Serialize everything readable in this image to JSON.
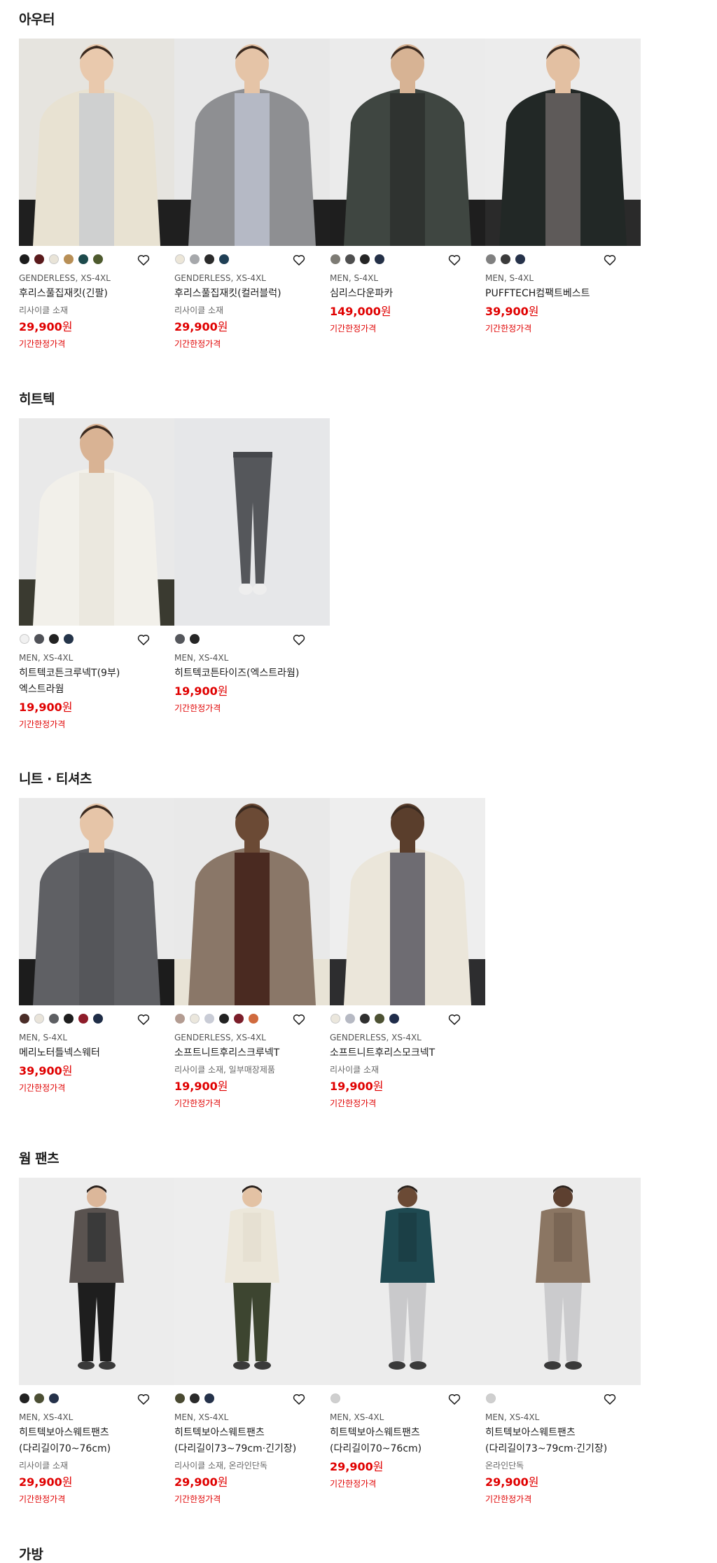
{
  "sections": [
    {
      "title": "아우터",
      "products": [
        {
          "swatches": [
            "#1c1c1c",
            "#5a1a1c",
            "#e9e4d8",
            "#b88f56",
            "#1d4a4c",
            "#4e5a2e"
          ],
          "meta": "GENDERLESS, XS-4XL",
          "name": "후리스풀집재킷(긴팔)",
          "note": "리사이클 소재",
          "price": "29,900",
          "currency": "원",
          "flag": "기간한정가격",
          "photo": {
            "bg": "#e6e4df",
            "top": "#e8e2d2",
            "inner": "#cfd0d0",
            "bottom": "#1f1f1f",
            "skin": "#e9c9ad"
          }
        },
        {
          "swatches": [
            "#ece6d8",
            "#a6a8ab",
            "#2b2b2b",
            "#1f3f55"
          ],
          "meta": "GENDERLESS, XS-4XL",
          "name": "후리스풀집재킷(컬러블럭)",
          "note": "리사이클 소재",
          "price": "29,900",
          "currency": "원",
          "flag": "기간한정가격",
          "photo": {
            "bg": "#e8e8e8",
            "top": "#8e8f92",
            "inner": "#b5b9c5",
            "bottom": "#1f1f1f",
            "skin": "#e5c4a7"
          }
        },
        {
          "swatches": [
            "#7d7b74",
            "#4f4f4f",
            "#252525",
            "#243047"
          ],
          "meta": "MEN, S-4XL",
          "name": "심리스다운파카",
          "note": "",
          "price": "149,000",
          "currency": "원",
          "flag": "기간한정가격",
          "photo": {
            "bg": "#ebebeb",
            "top": "#3f4641",
            "inner": "#2f3330",
            "bottom": "#1e1e1e",
            "skin": "#d7b394"
          }
        },
        {
          "swatches": [
            "#808080",
            "#3b3b3b",
            "#26324a"
          ],
          "meta": "MEN, S-4XL",
          "name": "PUFFTECH컴팩트베스트",
          "note": "",
          "price": "39,900",
          "currency": "원",
          "flag": "기간한정가격",
          "photo": {
            "bg": "#ececec",
            "top": "#222826",
            "inner": "#5e5a59",
            "bottom": "#2a2a2a",
            "skin": "#e3c0a2"
          }
        }
      ]
    },
    {
      "title": "히트텍",
      "products": [
        {
          "swatches": [
            "#f1f1f1",
            "#505258",
            "#222222",
            "#25354a"
          ],
          "meta": "MEN, XS-4XL",
          "name": "히트텍코튼크루넥T(9부)엑스트라웜",
          "note": "",
          "price": "19,900",
          "currency": "원",
          "flag": "기간한정가격",
          "photo": {
            "bg": "#e9e9e9",
            "top": "#f2f0ea",
            "inner": "#ebe8df",
            "bottom": "#3a3a30",
            "skin": "#d9b394"
          }
        },
        {
          "swatches": [
            "#55575c",
            "#262626"
          ],
          "meta": "MEN, XS-4XL",
          "name": "히트텍코튼타이즈(엑스트라웜)",
          "note": "",
          "price": "19,900",
          "currency": "원",
          "flag": "기간한정가격",
          "photo": {
            "bg": "#e6e7e9",
            "top": "#55575b",
            "inner": "#55575b",
            "bottom": "#55575b",
            "skin": "#eeeeee"
          }
        }
      ]
    },
    {
      "title": "니트 · 티셔츠",
      "products": [
        {
          "swatches": [
            "#4a2d28",
            "#e9e4da",
            "#5d5f63",
            "#1e1e1e",
            "#8e1c2a",
            "#1f2d47"
          ],
          "meta": "MEN, S-4XL",
          "name": "메리노터틀넥스웨터",
          "note": "",
          "price": "39,900",
          "currency": "원",
          "flag": "기간한정가격",
          "photo": {
            "bg": "#eaeaea",
            "top": "#5f6064",
            "inner": "#55565a",
            "bottom": "#1c1c1c",
            "skin": "#e6c5a8"
          }
        },
        {
          "swatches": [
            "#b39c92",
            "#ebe7dd",
            "#c9ccd6",
            "#222222",
            "#7b1e2a",
            "#d06a3e"
          ],
          "meta": "GENDERLESS, XS-4XL",
          "name": "소프트니트후리스크루넥T",
          "note": "리사이클 소재, 일부매장제품",
          "price": "19,900",
          "currency": "원",
          "flag": "기간한정가격",
          "photo": {
            "bg": "#e9e9e9",
            "top": "#8a7768",
            "inner": "#4a2a21",
            "bottom": "#e8e3d6",
            "skin": "#6b4a35"
          }
        },
        {
          "swatches": [
            "#ebe7dd",
            "#b6b9c3",
            "#2f2f2f",
            "#4d5233",
            "#1f2c4a"
          ],
          "meta": "GENDERLESS, XS-4XL",
          "name": "소프트니트후리스모크넥T",
          "note": "리사이클 소재",
          "price": "19,900",
          "currency": "원",
          "flag": "기간한정가격",
          "photo": {
            "bg": "#eeeeee",
            "top": "#ebe6da",
            "inner": "#6e6c72",
            "bottom": "#2d2d2f",
            "skin": "#5a3e2c"
          }
        }
      ]
    },
    {
      "title": "웜 팬츠",
      "products": [
        {
          "swatches": [
            "#222222",
            "#4c4f34",
            "#25324a"
          ],
          "meta": "MEN, XS-4XL",
          "name": "히트텍보아스웨트팬츠(다리길이70~76cm)",
          "note": "리사이클 소재",
          "price": "29,900",
          "currency": "원",
          "flag": "기간한정가격",
          "photo": {
            "bg": "#ececec",
            "top": "#5a5350",
            "inner": "#3a3a3a",
            "bottom": "#1e1e1e",
            "skin": "#dcb79a"
          }
        },
        {
          "swatches": [
            "#4a4a32",
            "#2a2a2a",
            "#25324a"
          ],
          "meta": "MEN, XS-4XL",
          "name": "히트텍보아스웨트팬츠(다리길이73~79cm·긴기장)",
          "note": "리사이클 소재, 온라인단독",
          "price": "29,900",
          "currency": "원",
          "flag": "기간한정가격",
          "photo": {
            "bg": "#ededed",
            "top": "#ece7da",
            "inner": "#e6e0d2",
            "bottom": "#3d4530",
            "skin": "#e3c2a4"
          }
        },
        {
          "swatches": [
            "#cfcfcf"
          ],
          "meta": "MEN, XS-4XL",
          "name": "히트텍보아스웨트팬츠(다리길이70~76cm)",
          "note": "",
          "price": "29,900",
          "currency": "원",
          "flag": "기간한정가격",
          "photo": {
            "bg": "#ececec",
            "top": "#1f4a52",
            "inner": "#1b3f46",
            "bottom": "#c9c9cb",
            "skin": "#6b4a35"
          }
        },
        {
          "swatches": [
            "#cfcfcf"
          ],
          "meta": "MEN, XS-4XL",
          "name": "히트텍보아스웨트팬츠(다리길이73~79cm·긴기장)",
          "note": "온라인단독",
          "price": "29,900",
          "currency": "원",
          "flag": "기간한정가격",
          "photo": {
            "bg": "#ececec",
            "top": "#8b7663",
            "inner": "#7a6655",
            "bottom": "#cbcbcd",
            "skin": "#5d4030"
          }
        }
      ]
    }
  ],
  "next_section_title": "가방"
}
